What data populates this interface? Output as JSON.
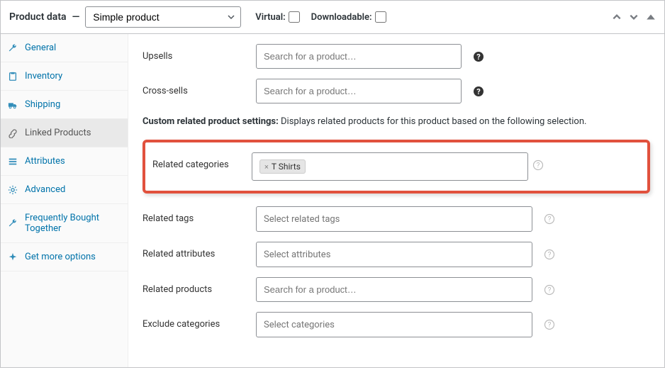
{
  "header": {
    "title_prefix": "Product data",
    "dash": "—",
    "type_select": "Simple product",
    "virtual_label": "Virtual:",
    "downloadable_label": "Downloadable:"
  },
  "sidebar": {
    "items": [
      {
        "label": "General"
      },
      {
        "label": "Inventory"
      },
      {
        "label": "Shipping"
      },
      {
        "label": "Linked Products"
      },
      {
        "label": "Attributes"
      },
      {
        "label": "Advanced"
      },
      {
        "label": "Frequently Bought Together"
      },
      {
        "label": "Get more options"
      }
    ]
  },
  "content": {
    "upsells_label": "Upsells",
    "upsells_placeholder": "Search for a product…",
    "crosssells_label": "Cross-sells",
    "crosssells_placeholder": "Search for a product…",
    "section_title": "Custom related product settings:",
    "section_desc": "Displays related products for this product based on the following selection.",
    "related_categories_label": "Related categories",
    "related_categories_tag": "T Shirts",
    "related_tags_label": "Related tags",
    "related_tags_placeholder": "Select related tags",
    "related_attributes_label": "Related attributes",
    "related_attributes_placeholder": "Select attributes",
    "related_products_label": "Related products",
    "related_products_placeholder": "Search for a product…",
    "exclude_categories_label": "Exclude categories",
    "exclude_categories_placeholder": "Select categories"
  }
}
